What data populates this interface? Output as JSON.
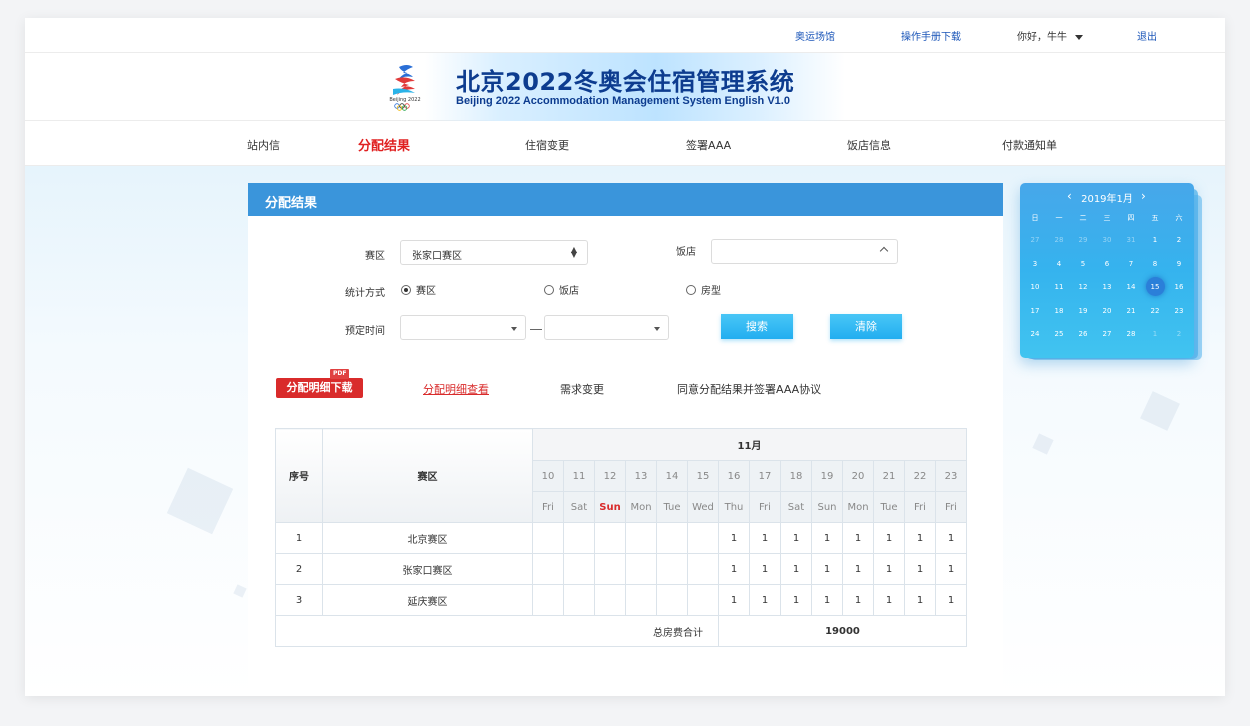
{
  "topbar": {
    "venue_link": "奥运场馆",
    "manual_link": "操作手册下载",
    "greeting": "你好，牛牛",
    "logout": "退出"
  },
  "banner": {
    "logo_text": "Beijing 2022",
    "title_cn": "北京2022冬奥会住宿管理系统",
    "title_en": "Beijing 2022 Accommodation Management System English V1.0"
  },
  "nav": {
    "items": [
      "站内信",
      "分配结果",
      "住宿变更",
      "签署AAA",
      "饭店信息",
      "付款通知单"
    ],
    "active_index": 1
  },
  "panel": {
    "title": "分配结果",
    "zone_label": "赛区",
    "zone_value": "张家口赛区",
    "hotel_label": "饭店",
    "hotel_value": "",
    "stat_label": "统计方式",
    "stat_options": [
      "赛区",
      "饭店",
      "房型"
    ],
    "stat_selected": 0,
    "time_label": "预定时间",
    "time_from": "",
    "time_to": "",
    "search_button": "搜索",
    "clear_button": "清除"
  },
  "actions": {
    "pdf_tag": "PDF",
    "download": "分配明细下载",
    "view": "分配明细查看",
    "change": "需求变更",
    "agree": "同意分配结果并签署AAA协议"
  },
  "table": {
    "col_index": "序号",
    "col_zone": "赛区",
    "month": "11月",
    "dates": [
      "10",
      "11",
      "12",
      "13",
      "14",
      "15",
      "16",
      "17",
      "18",
      "19",
      "20",
      "21",
      "22",
      "23"
    ],
    "weekdays": [
      "Fri",
      "Sat",
      "Sun",
      "Mon",
      "Tue",
      "Wed",
      "Thu",
      "Fri",
      "Sat",
      "Sun",
      "Mon",
      "Tue",
      "Fri",
      "Fri"
    ],
    "rows": [
      {
        "idx": "1",
        "zone": "北京赛区",
        "cells": [
          "",
          "",
          "",
          "",
          "",
          "",
          "1",
          "1",
          "1",
          "1",
          "1",
          "1",
          "1",
          "1"
        ]
      },
      {
        "idx": "2",
        "zone": "张家口赛区",
        "cells": [
          "",
          "",
          "",
          "",
          "",
          "",
          "1",
          "1",
          "1",
          "1",
          "1",
          "1",
          "1",
          "1"
        ]
      },
      {
        "idx": "3",
        "zone": "延庆赛区",
        "cells": [
          "",
          "",
          "",
          "",
          "",
          "",
          "1",
          "1",
          "1",
          "1",
          "1",
          "1",
          "1",
          "1"
        ]
      }
    ],
    "total_label": "总房费合计",
    "total_value": "19000"
  },
  "calendar": {
    "title": "2019年1月",
    "weekdays": [
      "日",
      "一",
      "二",
      "三",
      "四",
      "五",
      "六"
    ],
    "days": [
      [
        "27",
        "28",
        "29",
        "30",
        "31",
        "1",
        "2"
      ],
      [
        "3",
        "4",
        "5",
        "6",
        "7",
        "8",
        "9"
      ],
      [
        "10",
        "11",
        "12",
        "13",
        "14",
        "15",
        "16"
      ],
      [
        "17",
        "18",
        "19",
        "20",
        "21",
        "22",
        "23"
      ],
      [
        "24",
        "25",
        "26",
        "27",
        "28",
        "1",
        "2"
      ]
    ],
    "selected_day": "15",
    "colors": {
      "accent": "#3a95db",
      "button": "#22aef0",
      "active_nav": "#e02121"
    }
  }
}
